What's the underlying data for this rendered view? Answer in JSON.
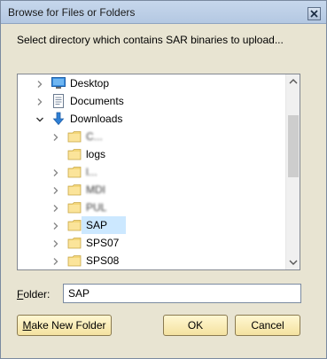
{
  "window": {
    "title": "Browse for Files or Folders"
  },
  "instruction": "Select directory which contains SAR binaries to upload...",
  "tree": {
    "items": [
      {
        "label": "Desktop",
        "expanded": false,
        "icon": "desktop-icon",
        "level": 0
      },
      {
        "label": "Documents",
        "expanded": false,
        "icon": "documents-icon",
        "level": 0
      },
      {
        "label": "Downloads",
        "expanded": true,
        "icon": "downloads-icon",
        "level": 0
      },
      {
        "label": "C...",
        "expanded": false,
        "icon": "folder-icon",
        "level": 1,
        "obscured": true
      },
      {
        "label": "logs",
        "expanded": null,
        "icon": "folder-icon",
        "level": 1
      },
      {
        "label": "l...",
        "expanded": false,
        "icon": "folder-icon",
        "level": 1,
        "obscured": true
      },
      {
        "label": "MDI",
        "expanded": false,
        "icon": "folder-icon",
        "level": 1,
        "obscured": true
      },
      {
        "label": "PUL",
        "expanded": false,
        "icon": "folder-icon",
        "level": 1,
        "obscured": true
      },
      {
        "label": "SAP",
        "expanded": false,
        "icon": "folder-icon",
        "level": 1,
        "selected": true
      },
      {
        "label": "SPS07",
        "expanded": false,
        "icon": "folder-icon",
        "level": 1
      },
      {
        "label": "SPS08",
        "expanded": false,
        "icon": "folder-icon",
        "level": 1
      }
    ]
  },
  "folder_field": {
    "label_accel": "F",
    "label_rest": "older:",
    "value": "SAP"
  },
  "buttons": {
    "new_folder_accel": "M",
    "new_folder_rest": "ake New Folder",
    "ok": "OK",
    "cancel": "Cancel"
  },
  "colors": {
    "dialog_bg": "#e8e4d2",
    "selection": "#cce8ff",
    "folder": "#f3d679",
    "downloads_arrow": "#2f7fd4"
  }
}
